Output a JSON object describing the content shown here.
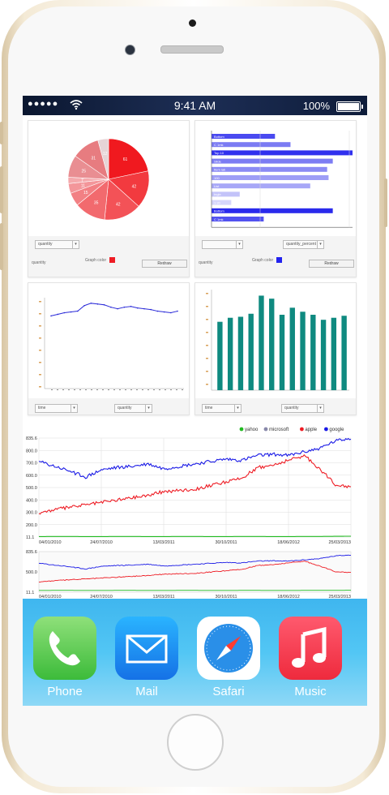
{
  "status_bar": {
    "signal": "●●●●●",
    "time": "9:41 AM",
    "battery": "100%",
    "battery_level": 1.0
  },
  "pie_panel": {
    "color_label": "Graph color",
    "control": "quantity",
    "redraw": "Redraw",
    "legend_label": "quantity",
    "color": "#ee1c24",
    "slice_labels": [
      "61",
      "42",
      "42",
      "35",
      "15",
      "11",
      "7",
      "25",
      "31",
      "12"
    ]
  },
  "bar_panel": {
    "color_label": "Graph color",
    "control": "quantity_percent",
    "redraw": "Redraw",
    "legend_label": "quantity",
    "color": "#2222ee",
    "bars": [
      {
        "label": "Bottom",
        "value": 0.45
      },
      {
        "label": "C 1mk",
        "value": 0.56
      },
      {
        "label": "Top 10",
        "value": 1.0
      },
      {
        "label": "Slide",
        "value": 0.86
      },
      {
        "label": "Item lab",
        "value": 0.82
      },
      {
        "label": "100",
        "value": 0.83
      },
      {
        "label": "List",
        "value": 0.7
      },
      {
        "label": "Ingle",
        "value": 0.2
      },
      {
        "label": "1 20",
        "value": 0.14
      },
      {
        "label": "Bottom",
        "value": 0.86
      },
      {
        "label": "C 1mk",
        "value": 0.37
      }
    ]
  },
  "line_panel": {
    "control_left": "time",
    "control_right": "quantity"
  },
  "column_panel": {
    "control_left": "time",
    "control_right": "quantity"
  },
  "stock_chart": {
    "legend": [
      {
        "name": "yahoo",
        "color": "#22bb22"
      },
      {
        "name": "microsoft",
        "color": "#8888aa"
      },
      {
        "name": "apple",
        "color": "#ee1c24"
      },
      {
        "name": "google",
        "color": "#1a1ae6"
      }
    ],
    "y_labels": [
      "835.6",
      "800.0",
      "700.0",
      "600.0",
      "500.0",
      "400.0",
      "300.0",
      "200.0",
      "11.1"
    ],
    "x_labels": [
      "04/01/2010",
      "24/07/2010",
      "13/03/2011",
      "30/10/2011",
      "18/06/2012",
      "25/03/2013"
    ],
    "nav_y_labels": [
      "835.6",
      "500.0",
      "11.1"
    ],
    "nav_x_labels": [
      "04/01/2010",
      "24/07/2010",
      "13/03/2011",
      "30/10/2011",
      "18/06/2012",
      "25/03/2013"
    ]
  },
  "dock": {
    "apps": [
      {
        "name": "Phone"
      },
      {
        "name": "Mail"
      },
      {
        "name": "Safari"
      },
      {
        "name": "Music"
      }
    ]
  },
  "chart_data": [
    {
      "type": "pie",
      "title": "",
      "values": [
        61,
        42,
        42,
        35,
        15,
        11,
        7,
        25,
        31,
        12
      ],
      "labels": [
        "61",
        "42",
        "42",
        "35",
        "15",
        "11",
        "7",
        "25",
        "31",
        "12"
      ]
    },
    {
      "type": "bar",
      "orientation": "horizontal",
      "categories": [
        "Bottom",
        "C 1mk",
        "Top 10",
        "Slide",
        "Item lab",
        "100",
        "List",
        "Ingle",
        "1 20",
        "Bottom",
        "C 1mk"
      ],
      "values": [
        0.45,
        0.56,
        1.0,
        0.86,
        0.82,
        0.83,
        0.7,
        0.2,
        0.14,
        0.86,
        0.37
      ]
    },
    {
      "type": "line",
      "values": [
        92,
        94,
        96,
        97,
        98,
        105,
        108,
        107,
        106,
        103,
        101,
        103,
        104,
        102,
        101,
        100,
        98,
        97,
        96,
        98
      ]
    },
    {
      "type": "bar",
      "values": [
        68,
        72,
        73,
        76,
        94,
        91,
        75,
        82,
        78,
        75,
        70,
        72,
        74
      ],
      "ylim": [
        0,
        100
      ]
    },
    {
      "type": "line",
      "x_labels": [
        "04/01/2010",
        "24/07/2010",
        "13/03/2011",
        "30/10/2011",
        "18/06/2012",
        "25/03/2013"
      ],
      "ylim": [
        11.1,
        835.6
      ],
      "series": [
        {
          "name": "google",
          "values": [
            640,
            600,
            560,
            510,
            570,
            590,
            600,
            620,
            580,
            600,
            620,
            640,
            660,
            650,
            690,
            700,
            690,
            720,
            750,
            810,
            835
          ]
        },
        {
          "name": "apple",
          "values": [
            210,
            240,
            260,
            280,
            300,
            320,
            340,
            360,
            390,
            400,
            410,
            440,
            470,
            500,
            590,
            610,
            650,
            690,
            580,
            450,
            430
          ]
        },
        {
          "name": "yahoo",
          "values": [
            15,
            16,
            16,
            15,
            15,
            16,
            16,
            15,
            15,
            16,
            16,
            15,
            15,
            16,
            16,
            15,
            15,
            16,
            16,
            17,
            18
          ]
        }
      ]
    }
  ]
}
